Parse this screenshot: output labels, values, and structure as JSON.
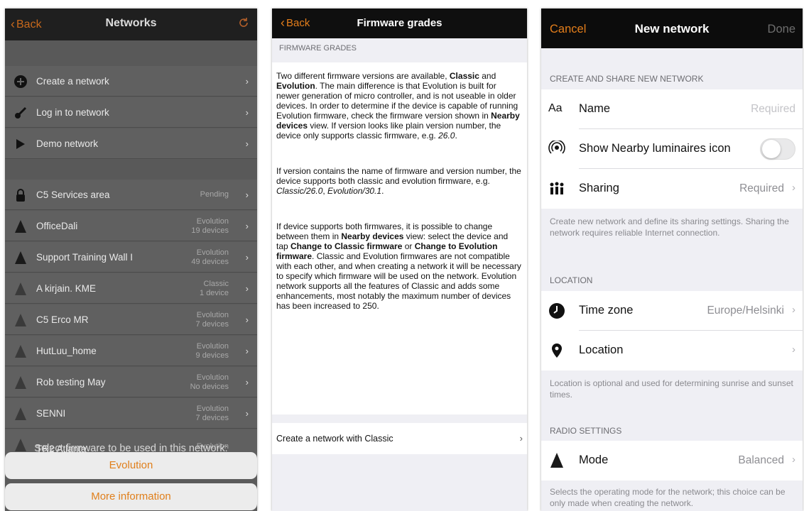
{
  "phone1": {
    "back_label": "Back",
    "title": "Networks",
    "menu": [
      {
        "label": "Create a network",
        "icon": "plus-circle-icon"
      },
      {
        "label": "Log in to network",
        "icon": "key-icon"
      },
      {
        "label": "Demo network",
        "icon": "play-icon"
      }
    ],
    "networks": [
      {
        "label": "C5 Services area",
        "status1": "Pending",
        "status2": "",
        "icon": "lock-icon"
      },
      {
        "label": "OfficeDali",
        "status1": "Evolution",
        "status2": "19 devices",
        "icon": "network-a-icon"
      },
      {
        "label": "Support Training Wall  I",
        "status1": "Evolution",
        "status2": "49 devices",
        "icon": "network-a-icon"
      },
      {
        "label": "A kirjain. KME",
        "status1": "Classic",
        "status2": "1 device",
        "icon": "network-a-icon"
      },
      {
        "label": "C5 Erco MR",
        "status1": "Evolution",
        "status2": "7 devices",
        "icon": "network-a-icon"
      },
      {
        "label": "HutLuu_home",
        "status1": "Evolution",
        "status2": "9 devices",
        "icon": "network-a-icon"
      },
      {
        "label": "Rob testing May",
        "status1": "Evolution",
        "status2": "No devices",
        "icon": "network-a-icon"
      },
      {
        "label": "SENNI",
        "status1": "Evolution",
        "status2": "7 devices",
        "icon": "network-a-icon"
      },
      {
        "label": "TR2 Atlanta",
        "status1": "Evolution",
        "status2": "",
        "icon": "network-a-icon"
      }
    ],
    "sheet_title": "Select firmware to be used in this network:",
    "sheet_button_1": "Evolution",
    "sheet_button_2": "More information"
  },
  "phone2": {
    "back_label": "Back",
    "title": "Firmware grades",
    "section_header": "FIRMWARE GRADES",
    "create_row_label": "Create a network with Classic"
  },
  "phone3": {
    "cancel_label": "Cancel",
    "title": "New network",
    "done_label": "Done",
    "section_create": "CREATE AND SHARE NEW NETWORK",
    "name_icon": "Aa",
    "name_label": "Name",
    "name_placeholder": "Required",
    "nearby_label": "Show Nearby luminaires icon",
    "sharing_label": "Sharing",
    "sharing_value": "Required",
    "note_create": "Create new network and define its sharing settings. Sharing the network requires reliable Internet connection.",
    "section_location": "LOCATION",
    "timezone_label": "Time zone",
    "timezone_value": "Europe/Helsinki",
    "location_label": "Location",
    "note_location": "Location is optional and used for determining sunrise and sunset times.",
    "section_radio": "RADIO SETTINGS",
    "mode_label": "Mode",
    "mode_value": "Balanced",
    "note_mode": "Selects the operating mode for the network; this choice can be only made when creating the network."
  },
  "colors": {
    "accent": "#e47e1b",
    "nav_bg": "#0f0f0f",
    "group_bg": "#efeff4"
  }
}
